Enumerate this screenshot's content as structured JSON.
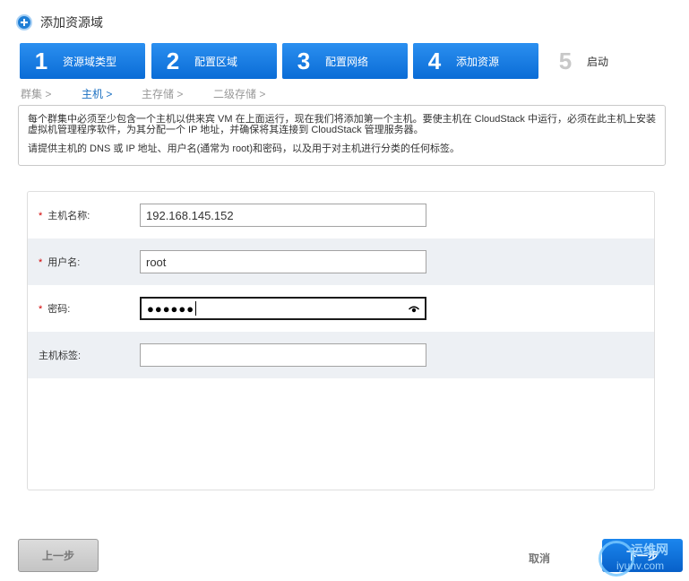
{
  "header": {
    "title": "添加资源域"
  },
  "steps": [
    {
      "num": "1",
      "label": "资源域类型"
    },
    {
      "num": "2",
      "label": "配置区域"
    },
    {
      "num": "3",
      "label": "配置网络"
    },
    {
      "num": "4",
      "label": "添加资源"
    },
    {
      "num": "5",
      "label": "启动"
    }
  ],
  "breadcrumb": [
    {
      "label": "群集 >"
    },
    {
      "label": "主机 >"
    },
    {
      "label": "主存储 >"
    },
    {
      "label": "二级存储 >"
    }
  ],
  "description": {
    "line1": "每个群集中必须至少包含一个主机以供来宾 VM 在上面运行，现在我们将添加第一个主机。要使主机在 CloudStack 中运行，必须在此主机上安装虚拟机管理程序软件，为其分配一个 IP 地址，并确保将其连接到 CloudStack 管理服务器。",
    "line2": "请提供主机的 DNS 或 IP 地址、用户名(通常为 root)和密码，以及用于对主机进行分类的任何标签。"
  },
  "form": {
    "required_mark": "*",
    "host_name": {
      "label": "主机名称:",
      "value": "192.168.145.152"
    },
    "username": {
      "label": "用户名:",
      "value": "root"
    },
    "password": {
      "label": "密码:",
      "value": "●●●●●●"
    },
    "host_tags": {
      "label": "主机标签:",
      "value": ""
    }
  },
  "buttons": {
    "prev": "上一步",
    "cancel": "取消",
    "next": "下一步"
  },
  "watermark": {
    "text1": "运维网",
    "text2": "iyunv.com"
  },
  "colors": {
    "step_blue": "#0a6cd6",
    "required_red": "#d20000",
    "alt_row": "#edf0f4"
  }
}
